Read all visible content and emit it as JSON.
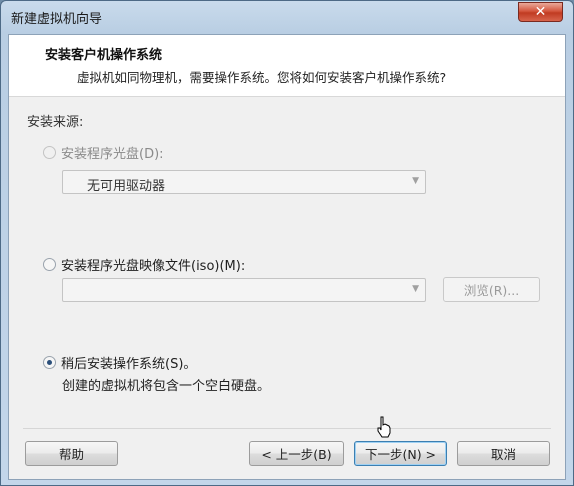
{
  "window": {
    "title": "新建虚拟机向导",
    "close_label": "✕"
  },
  "header": {
    "title": "安装客户机操作系统",
    "subtitle": "虚拟机如同物理机，需要操作系统。您将如何安装客户机操作系统?"
  },
  "source": {
    "label": "安装来源:",
    "disc_option": "安装程序光盘(D):",
    "disc_drive_value": "无可用驱动器",
    "iso_option": "安装程序光盘映像文件(iso)(M):",
    "iso_path_value": "",
    "browse_label": "浏览(R)...",
    "later_option": "稍后安装操作系统(S)。",
    "later_description": "创建的虚拟机将包含一个空白硬盘。"
  },
  "buttons": {
    "help": "帮助",
    "back": "< 上一步(B)",
    "next": "下一步(N) >",
    "cancel": "取消"
  }
}
